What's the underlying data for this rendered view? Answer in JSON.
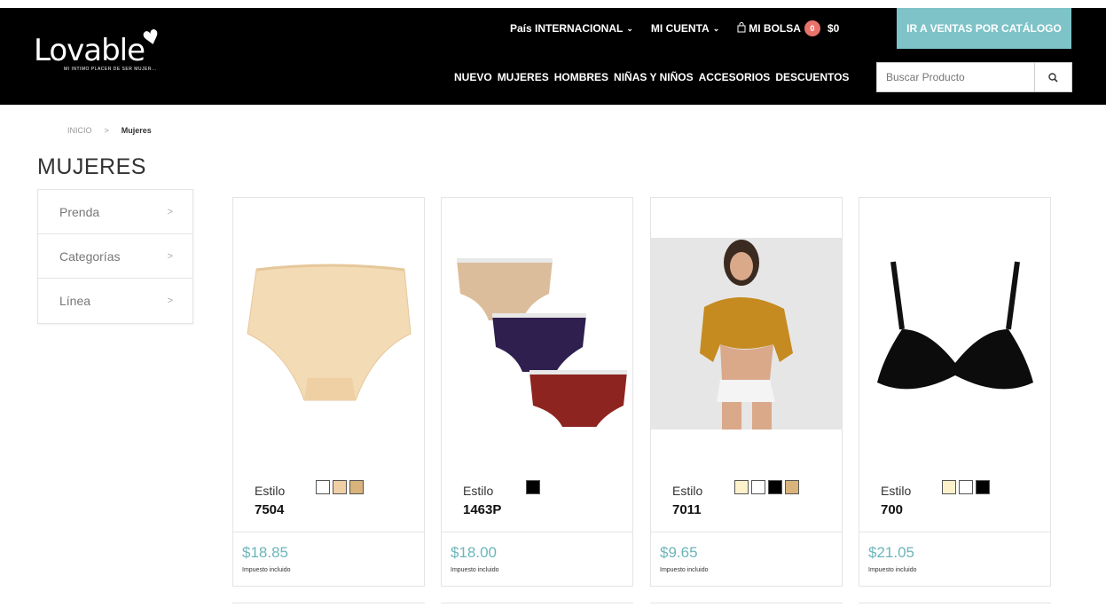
{
  "header": {
    "logo_text": "Lovable",
    "tagline": "MI INTIMO PLACER DE SER MUJER...",
    "country_label": "País INTERNACIONAL",
    "account_label": "MI CUENTA",
    "bag_label": "MI BOLSA",
    "bag_count": "0",
    "bag_total": "$0",
    "catalog_button": "IR A VENTAS POR CATÁLOGO",
    "nav": [
      "NUEVO",
      "MUJERES",
      "HOMBRES",
      "NIÑAS Y NIÑOS",
      "ACCESORIOS",
      "DESCUENTOS"
    ],
    "search_placeholder": "Buscar Producto"
  },
  "breadcrumb": {
    "home": "INICIO",
    "separator": ">",
    "current": "Mujeres"
  },
  "page_title": "MUJERES",
  "filters": [
    {
      "label": "Prenda"
    },
    {
      "label": "Categorías"
    },
    {
      "label": "Línea"
    }
  ],
  "products": [
    {
      "style_label": "Estilo",
      "code": "7504",
      "price": "$18.85",
      "tax_note": "Impuesto incluido",
      "swatches": [
        "#ffffff",
        "#f0cfa4",
        "#d9b37b"
      ]
    },
    {
      "style_label": "Estilo",
      "code": "1463P",
      "price": "$18.00",
      "tax_note": "Impuesto incluido",
      "swatches": [
        "#000000"
      ]
    },
    {
      "style_label": "Estilo",
      "code": "7011",
      "price": "$9.65",
      "tax_note": "Impuesto incluido",
      "swatches": [
        "#fdf1cc",
        "#ffffff",
        "#000000",
        "#d9b37b"
      ]
    },
    {
      "style_label": "Estilo",
      "code": "700",
      "price": "$21.05",
      "tax_note": "Impuesto incluido",
      "swatches": [
        "#fdf1cc",
        "#ffffff",
        "#000000"
      ]
    }
  ],
  "colors": {
    "header_bg": "#000000",
    "accent": "#7dc3c8",
    "price": "#6cb5bb",
    "badge": "#e8736b"
  }
}
